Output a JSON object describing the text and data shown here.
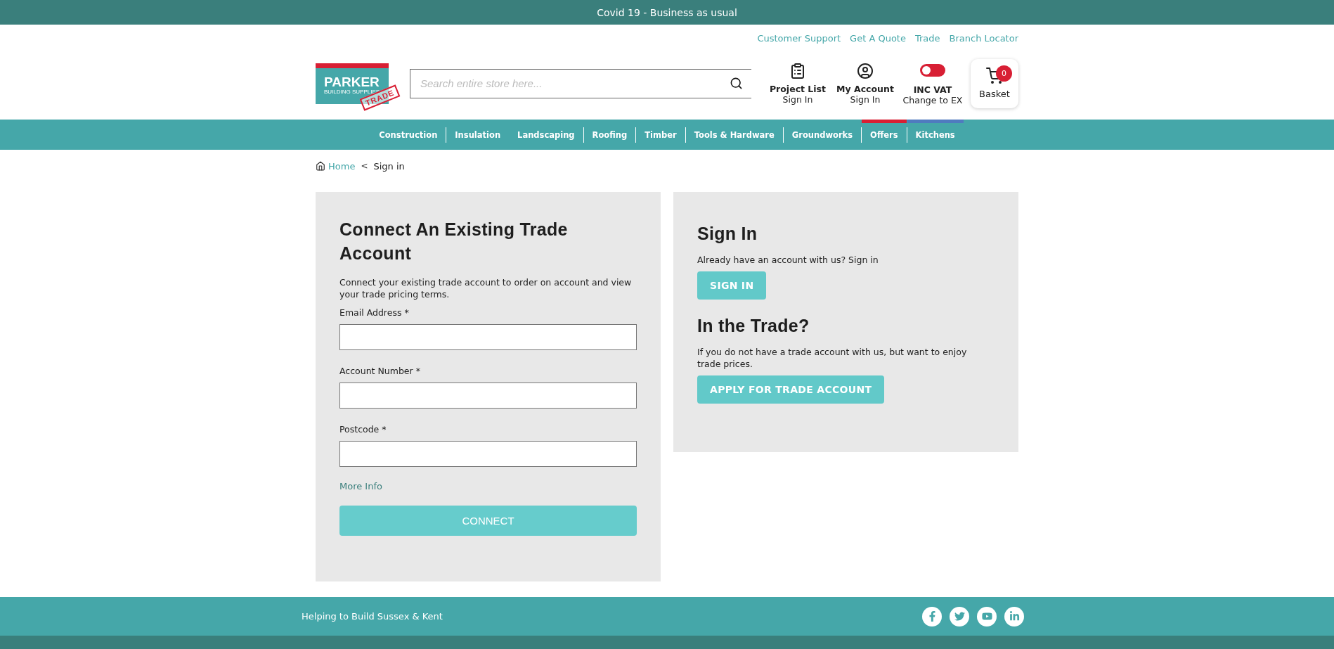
{
  "banner": {
    "text": "Covid 19 - Business as usual"
  },
  "top_links": [
    "Customer Support",
    "Get A Quote",
    "Trade",
    "Branch Locator"
  ],
  "logo": {
    "name": "PARKER",
    "tagline": "BUILDING SUPPLIES",
    "stamp": "TRADE"
  },
  "search": {
    "placeholder": "Search entire store here..."
  },
  "header_actions": [
    {
      "kind": "project",
      "title": "Project List",
      "subtitle": "Sign In"
    },
    {
      "kind": "account",
      "title": "My Account",
      "subtitle": "Sign In"
    },
    {
      "kind": "vat",
      "title": "INC VAT",
      "subtitle": "Change to EX",
      "on": false
    }
  ],
  "basket": {
    "label": "Basket",
    "count": "0"
  },
  "nav": [
    {
      "label": "Construction",
      "divider": false
    },
    {
      "label": "Insulation",
      "divider": true
    },
    {
      "label": "Landscaping",
      "divider": false
    },
    {
      "label": "Roofing",
      "divider": true
    },
    {
      "label": "Timber",
      "divider": true
    },
    {
      "label": "Tools & Hardware",
      "divider": true
    },
    {
      "label": "Groundworks",
      "divider": true
    },
    {
      "label": "Offers",
      "divider": true,
      "color": "#d81f34"
    },
    {
      "label": "Kitchens",
      "divider": true,
      "color": "#4f7bbf"
    }
  ],
  "breadcrumb": [
    {
      "label": "Home"
    },
    {
      "label": "Sign in"
    }
  ],
  "breadcrumb_separator": "<",
  "connect_panel": {
    "title": "Connect An Existing Trade Account",
    "intro": "Connect your existing trade account to order on account and view your trade pricing terms.",
    "fields": [
      {
        "label": "Email Address *"
      },
      {
        "label": "Account Number *"
      },
      {
        "label": "Postcode *"
      }
    ],
    "more_info": "More Info",
    "button": "CONNECT"
  },
  "signin_panel": {
    "title": "Sign In",
    "text": "Already have an account with us? Sign in",
    "button": "SIGN IN",
    "trade_title": "In the Trade?",
    "trade_text": "If you do not have a trade account with us, but want to enjoy trade prices.",
    "trade_button": "APPLY FOR TRADE ACCOUNT"
  },
  "footer": {
    "tagline": "Helping to Build Sussex & Kent",
    "social": [
      {
        "kind": "facebook"
      },
      {
        "kind": "twitter"
      },
      {
        "kind": "youtube"
      },
      {
        "kind": "linkedin"
      }
    ]
  }
}
